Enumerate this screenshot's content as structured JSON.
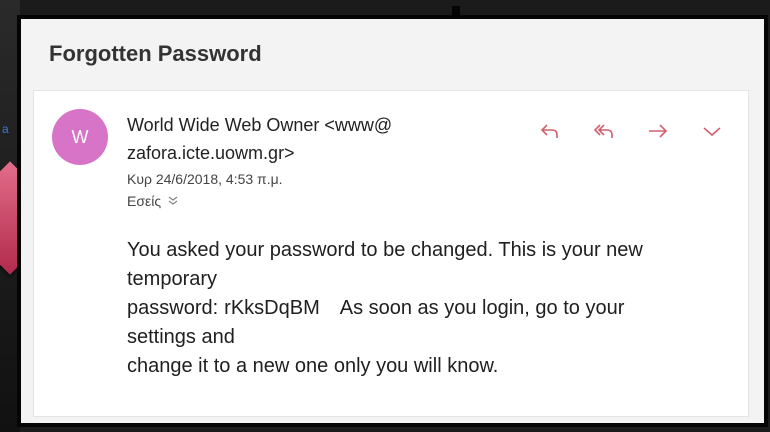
{
  "background": {
    "fragment_text": "a"
  },
  "email": {
    "subject": "Forgotten Password",
    "avatar_initial": "W",
    "sender_line1": "World Wide Web Owner <www@",
    "sender_line2": "zafora.icte.uowm.gr>",
    "date": "Κυρ 24/6/2018, 4:53 π.μ.",
    "recipients": "Εσείς",
    "actions": [
      {
        "name": "reply-icon",
        "glyph": "↶"
      },
      {
        "name": "reply-all-icon",
        "glyph": "⟲"
      },
      {
        "name": "forward-icon",
        "glyph": "→"
      },
      {
        "name": "more-actions-chevron-icon",
        "glyph": "⌄"
      }
    ],
    "body": {
      "line1": "You asked your password to be changed. This is your new",
      "line2": "temporary",
      "line3_prefix": "password:",
      "password": "rKksDqBM",
      "line3_suffix": "As soon as you login, go to your",
      "line4": "settings and",
      "line5": "change it to a new one only you will know."
    }
  },
  "colors": {
    "avatar": "#d774c8",
    "action_icons": "#d0606d"
  }
}
